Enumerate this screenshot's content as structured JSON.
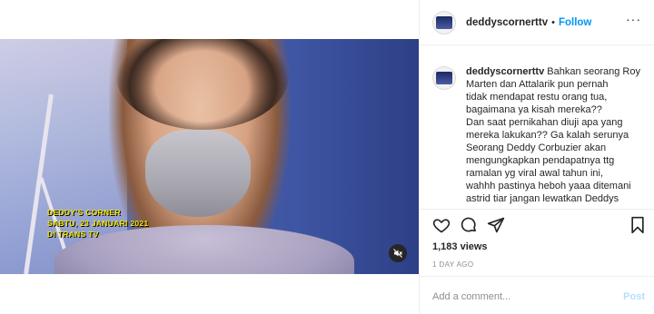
{
  "post": {
    "username": "deddyscornerttv",
    "follow_label": "Follow",
    "separator": "•",
    "more_glyph": "···",
    "caption_user": "deddyscornerttv",
    "caption_lines": [
      "Bahkan seorang Roy",
      "Marten dan Attalarik pun pernah",
      "tidak mendapat restu orang tua,",
      "bagaimana ya kisah mereka??",
      "Dan saat pernikahan diuji apa yang",
      "mereka lakukan?? Ga kalah serunya",
      "Seorang Deddy Corbuzier akan",
      "mengungkapkan pendapatnya ttg",
      "ramalan yg viral awal tahun ini,",
      "wahhh pastinya heboh yaaa ditemani",
      "astrid tiar jangan lewatkan Deddys"
    ],
    "views": "1,183 views",
    "time_ago": "1 DAY AGO",
    "comment_placeholder": "Add a comment...",
    "post_label": "Post"
  },
  "video": {
    "caption_line1": "DEDDY'S CORNER",
    "caption_line2": "SABTU, 23 JANUARI 2021",
    "caption_line3": "DI TRANS TV",
    "mute_icon": "speaker-muted-icon"
  },
  "icons": {
    "like": "heart-icon",
    "comment": "comment-bubble-icon",
    "share": "paper-plane-icon",
    "save": "bookmark-icon"
  },
  "colors": {
    "accent": "#0095f6",
    "post_disabled": "#b2dffc",
    "caption_yellow": "#f3e600"
  }
}
